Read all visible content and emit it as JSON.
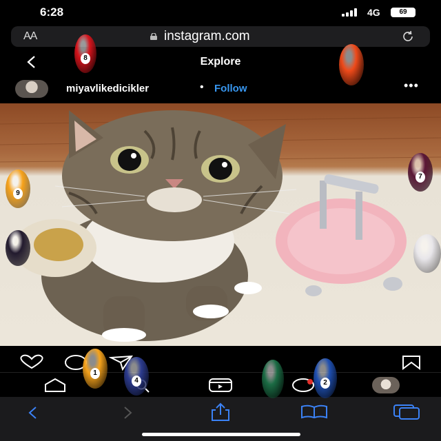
{
  "status": {
    "time": "6:28",
    "network": "4G",
    "battery": "69"
  },
  "browser": {
    "text_size_label": "AA",
    "url": "instagram.com"
  },
  "header": {
    "title": "Explore"
  },
  "post": {
    "username": "miyavlikedicikler",
    "separator": "•",
    "follow_label": "Follow",
    "more_label": "•••"
  },
  "balls": [
    {
      "number": "8",
      "color": "#d6141c"
    },
    {
      "number": "",
      "color": "#ef4a1a"
    },
    {
      "number": "9",
      "color": "#f7a21a"
    },
    {
      "number": "7",
      "color": "#5a1636"
    },
    {
      "number": "",
      "color": "#221a2e"
    },
    {
      "number": "",
      "color": "#e8e6ea"
    },
    {
      "number": "1",
      "color": "#f6a31c"
    },
    {
      "number": "4",
      "color": "#2c3b8e"
    },
    {
      "number": "",
      "color": "#1b6b44"
    },
    {
      "number": "2",
      "color": "#1f4fb0"
    }
  ],
  "colors": {
    "accent": "#3897f0",
    "safari_tint": "#3b82f6"
  }
}
